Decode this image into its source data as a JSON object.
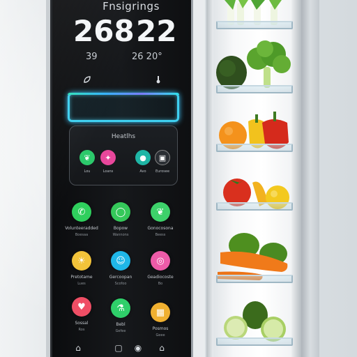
{
  "display": {
    "title": "Fnsigrings",
    "primary_left": "268",
    "primary_right": "22",
    "secondary_left": "39",
    "secondary_right": "26 20°",
    "health_label": "Heatlhs",
    "health_apps": [
      {
        "icon": "leaf-icon",
        "color": "#2cc96b",
        "caption": "Lou"
      },
      {
        "icon": "runner-icon",
        "color": "#e8479b",
        "caption": "Loans"
      },
      {
        "icon": "drop-icon",
        "color": "#1fb6a6",
        "caption": "Avo"
      },
      {
        "icon": "phone-icon",
        "color": "#2a2e33",
        "caption": "Eurosee"
      }
    ],
    "apps": [
      {
        "icon": "phone-icon",
        "color": "#2fcf5d",
        "caption": "Volunteeradded",
        "sub": "Boesaa"
      },
      {
        "icon": "chat-icon",
        "color": "#35c85a",
        "caption": "Bopow",
        "sub": "Wannons"
      },
      {
        "icon": "leaf-icon",
        "color": "#3dd16a",
        "caption": "Gonocosona",
        "sub": "Beess"
      },
      {
        "icon": "sun-icon",
        "color": "#f2c33a",
        "caption": "Pretotame",
        "sub": "Lues"
      },
      {
        "icon": "person-icon",
        "color": "#1fb7e8",
        "caption": "Gercoopan",
        "sub": "Scofoo"
      },
      {
        "icon": "target-icon",
        "color": "#ee5ba8",
        "caption": "Geadiocoste",
        "sub": "Bo"
      },
      {
        "icon": "heart-icon",
        "color": "#ef4e65",
        "caption": "Sossal",
        "sub": "Ros"
      },
      {
        "icon": "flask-icon",
        "color": "#2fcf6a",
        "caption": "Bebl",
        "sub": "Gefee"
      },
      {
        "icon": "cube-icon",
        "color": "#f0b030",
        "caption": "Posmos",
        "sub": "Geee"
      }
    ],
    "bottom_icons": [
      "home-icon",
      "grid-icon",
      "user-icon",
      "house-icon"
    ]
  },
  "compartment": {
    "shelves": [
      {
        "food": "leeks"
      },
      {
        "food": "avocado, broccoli"
      },
      {
        "food": "orange, peppers"
      },
      {
        "food": "tomato, banana, apple"
      },
      {
        "food": "carrots, avocados"
      },
      {
        "food": "cucumbers, avocado"
      }
    ]
  }
}
